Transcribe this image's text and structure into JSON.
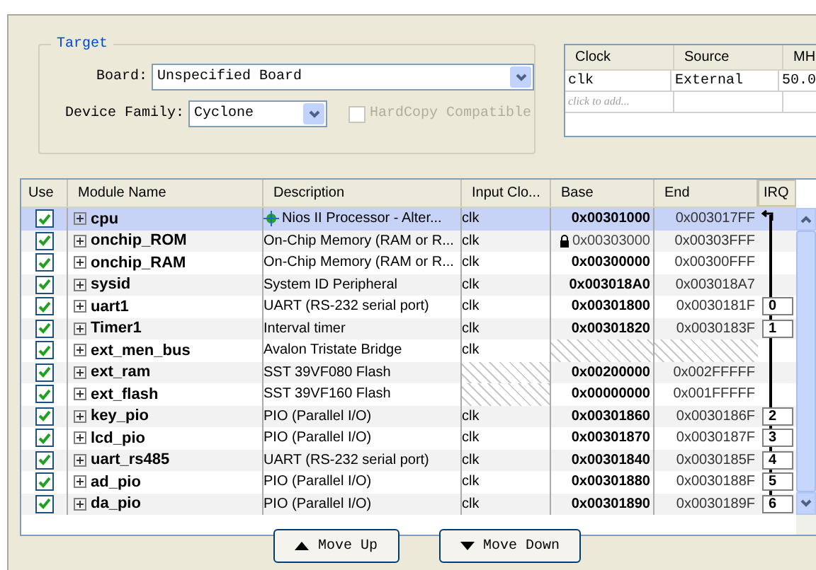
{
  "target": {
    "title": "Target",
    "board_label": "Board:",
    "board": "Unspecified Board",
    "family_label": "Device Family:",
    "family": "Cyclone",
    "hardcopy": {
      "label": "HardCopy Compatible",
      "checked": false,
      "disabled": true
    }
  },
  "clocks": {
    "columns": [
      "Clock",
      "Source",
      "MH"
    ],
    "rows": [
      [
        "clk",
        "External",
        "50.0"
      ]
    ],
    "placeholder": "click to add..."
  },
  "modules": {
    "columns": [
      "Use",
      "Module Name",
      "Description",
      "Input Clo...",
      "Base",
      "End",
      "IRQ"
    ],
    "rows": [
      {
        "checked": true,
        "selected": true,
        "name": "cpu",
        "description": "Nios II Processor - Alter...",
        "kind": "processor",
        "clock": "clk",
        "base": "0x00301000",
        "locked": false,
        "end": "0x003017FF"
      },
      {
        "checked": true,
        "selected": false,
        "name": "onchip_ROM",
        "description": "On-Chip Memory (RAM or R...",
        "clock": "clk",
        "base": "0x00303000",
        "locked": true,
        "end": "0x00303FFF"
      },
      {
        "checked": true,
        "selected": false,
        "name": "onchip_RAM",
        "description": "On-Chip Memory (RAM or R...",
        "clock": "clk",
        "base": "0x00300000",
        "locked": false,
        "end": "0x00300FFF"
      },
      {
        "checked": true,
        "selected": false,
        "name": "sysid",
        "description": "System ID Peripheral",
        "clock": "clk",
        "base": "0x003018A0",
        "locked": false,
        "end": "0x003018A7"
      },
      {
        "checked": true,
        "selected": false,
        "name": "uart1",
        "description": "UART (RS-232 serial port)",
        "clock": "clk",
        "base": "0x00301800",
        "locked": false,
        "end": "0x0030181F",
        "irq": "0"
      },
      {
        "checked": true,
        "selected": false,
        "name": "Timer1",
        "description": "Interval timer",
        "clock": "clk",
        "base": "0x00301820",
        "locked": false,
        "end": "0x0030183F",
        "irq": "1"
      },
      {
        "checked": true,
        "selected": false,
        "name": "ext_men_bus",
        "description": "Avalon Tristate Bridge",
        "clock": "clk",
        "locked": false
      },
      {
        "checked": true,
        "selected": false,
        "name": "ext_ram",
        "description": "SST 39VF080 Flash",
        "base": "0x00200000",
        "locked": false,
        "end": "0x002FFFFF"
      },
      {
        "checked": true,
        "selected": false,
        "name": "ext_flash",
        "description": "SST 39VF160 Flash",
        "base": "0x00000000",
        "locked": false,
        "end": "0x001FFFFF"
      },
      {
        "checked": true,
        "selected": false,
        "name": "key_pio",
        "description": "PIO (Parallel I/O)",
        "clock": "clk",
        "base": "0x00301860",
        "locked": false,
        "end": "0x0030186F",
        "irq": "2"
      },
      {
        "checked": true,
        "selected": false,
        "name": "lcd_pio",
        "description": "PIO (Parallel I/O)",
        "clock": "clk",
        "base": "0x00301870",
        "locked": false,
        "end": "0x0030187F",
        "irq": "3"
      },
      {
        "checked": true,
        "selected": false,
        "name": "uart_rs485",
        "description": "UART (RS-232 serial port)",
        "clock": "clk",
        "base": "0x00301840",
        "locked": false,
        "end": "0x0030185F",
        "irq": "4"
      },
      {
        "checked": true,
        "selected": false,
        "name": "ad_pio",
        "description": "PIO (Parallel I/O)",
        "clock": "clk",
        "base": "0x00301880",
        "locked": false,
        "end": "0x0030188F",
        "irq": "5"
      },
      {
        "checked": true,
        "selected": false,
        "name": "da_pio",
        "description": "PIO (Parallel I/O)",
        "clock": "clk",
        "base": "0x00301890",
        "locked": false,
        "end": "0x0030189F",
        "irq": "6"
      }
    ]
  },
  "buttons": [
    {
      "label": "Move Up",
      "kind": "up"
    },
    {
      "label": "Move Down",
      "kind": "down"
    }
  ]
}
